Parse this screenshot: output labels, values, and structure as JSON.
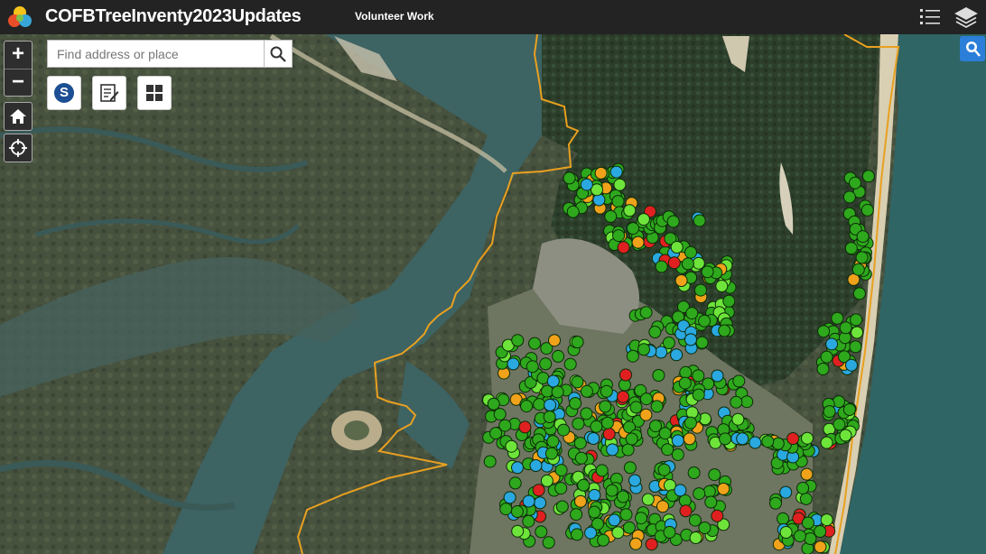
{
  "header": {
    "title": "COFBTreeInventy2023Updates",
    "subtitle": "Volunteer Work",
    "legend_icon": "legend-list-icon",
    "layers_icon": "layers-icon"
  },
  "map_controls": {
    "zoom_in_label": "+",
    "zoom_out_label": "−",
    "home_icon": "home-icon",
    "locate_icon": "locate-crosshair-icon"
  },
  "search": {
    "placeholder": "Find address or place",
    "value": "",
    "button_icon": "search-icon"
  },
  "toolbar": {
    "s_label": "S",
    "edit_icon": "edit-icon",
    "basemap_icon": "basemap-gallery-icon"
  },
  "right_widget": {
    "icon": "zoom-search-icon"
  },
  "colors": {
    "header_bg": "#232323",
    "point_green": "#2ea81c",
    "point_light_green": "#6ee43a",
    "point_blue": "#2aa8e0",
    "point_orange": "#f0a21a",
    "point_red": "#e02020",
    "boundary": "#e8a020",
    "widget_blue": "#2b7fd9"
  }
}
